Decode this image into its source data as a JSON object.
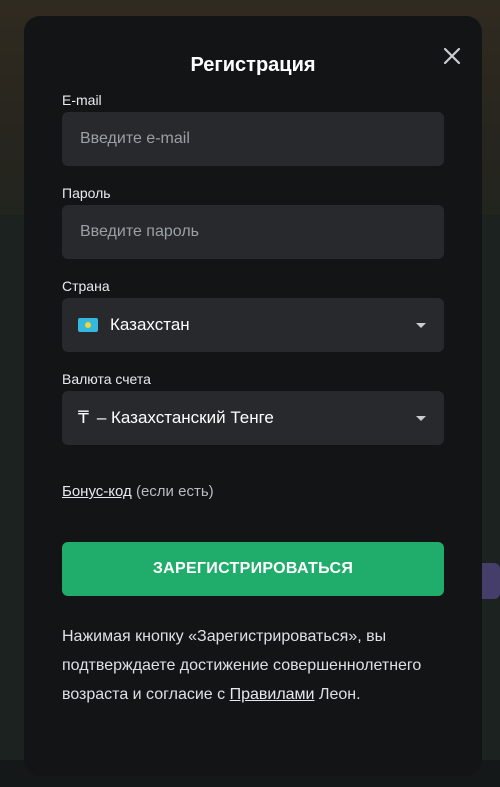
{
  "modal": {
    "title": "Регистрация",
    "email": {
      "label": "E-mail",
      "placeholder": "Введите e-mail"
    },
    "password": {
      "label": "Пароль",
      "placeholder": "Введите пароль"
    },
    "country": {
      "label": "Страна",
      "value": "Казахстан",
      "flag_icon": "kazakhstan-flag-icon"
    },
    "currency": {
      "label": "Валюта счета",
      "symbol": "₸",
      "value": "– Казахстанский Тенге"
    },
    "bonus": {
      "link": "Бонус-код",
      "suffix": "(если есть)"
    },
    "submit_label": "ЗАРЕГИСТРИРОВАТЬСЯ",
    "disclaimer": {
      "text": "Нажимая кнопку «Зарегистрироваться», вы подтверждаете достижение совершеннолетнего возраста и согласие с",
      "link": "Правилами",
      "tail": "Леон."
    }
  },
  "colors": {
    "modal_bg": "#131416",
    "field_bg": "#27292d",
    "accent_green": "#20ad6b"
  }
}
